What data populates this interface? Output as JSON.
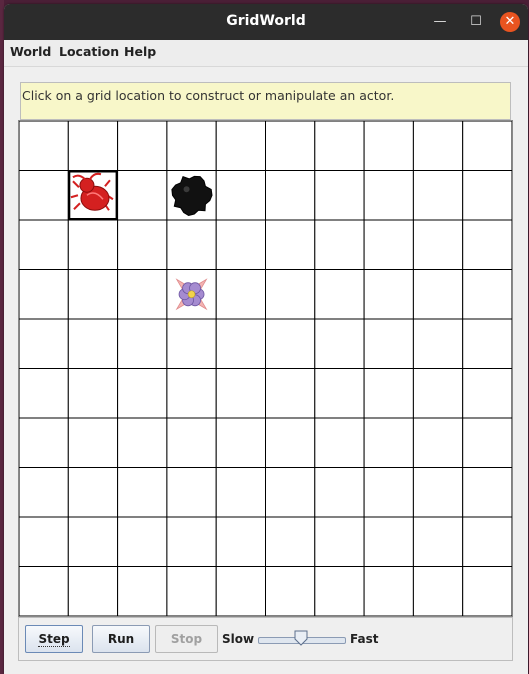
{
  "window": {
    "title": "GridWorld",
    "minimize_glyph": "—",
    "maximize_glyph": "☐",
    "close_glyph": "✕"
  },
  "menu": {
    "items": [
      {
        "label": "World"
      },
      {
        "label": "Location"
      },
      {
        "label": "Help"
      }
    ]
  },
  "message": "Click on a grid location to construct or manipulate an actor.",
  "grid": {
    "rows": 10,
    "cols": 10,
    "selected_cell": {
      "row": 1,
      "col": 1
    },
    "actors": [
      {
        "type": "bug",
        "row": 1,
        "col": 1,
        "color": "#d42020",
        "icon": "bug-icon"
      },
      {
        "type": "rock",
        "row": 1,
        "col": 3,
        "color": "#111111",
        "icon": "rock-icon"
      },
      {
        "type": "flower",
        "row": 3,
        "col": 3,
        "color": "#a58bd0",
        "icon": "flower-icon"
      }
    ]
  },
  "controls": {
    "step_label": "Step",
    "run_label": "Run",
    "stop_label": "Stop",
    "slow_label": "Slow",
    "fast_label": "Fast",
    "speed_fraction": 0.5
  }
}
